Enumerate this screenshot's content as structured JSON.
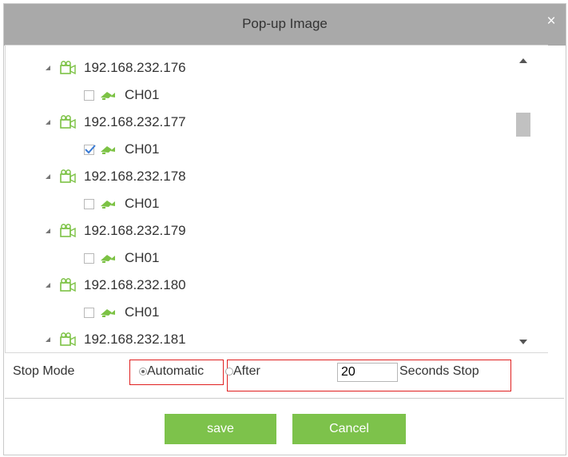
{
  "dialog": {
    "title": "Pop-up Image",
    "close_glyph": "×"
  },
  "tree": {
    "devices": [
      {
        "ip": "192.168.232.176",
        "channel": "CH01",
        "checked": false
      },
      {
        "ip": "192.168.232.177",
        "channel": "CH01",
        "checked": true
      },
      {
        "ip": "192.168.232.178",
        "channel": "CH01",
        "checked": false
      },
      {
        "ip": "192.168.232.179",
        "channel": "CH01",
        "checked": false
      },
      {
        "ip": "192.168.232.180",
        "channel": "CH01",
        "checked": false
      },
      {
        "ip": "192.168.232.181"
      }
    ]
  },
  "stop_mode": {
    "label": "Stop Mode",
    "automatic_label": "Automatic",
    "after_label": "After",
    "seconds_value": "20",
    "seconds_suffix": "Seconds Stop",
    "selected": "automatic"
  },
  "buttons": {
    "save": "save",
    "cancel": "Cancel"
  },
  "colors": {
    "titlebar": "#a9a9a9",
    "button_green": "#7dc24b",
    "icon_green": "#7cc244",
    "highlight_red": "#e02020"
  }
}
